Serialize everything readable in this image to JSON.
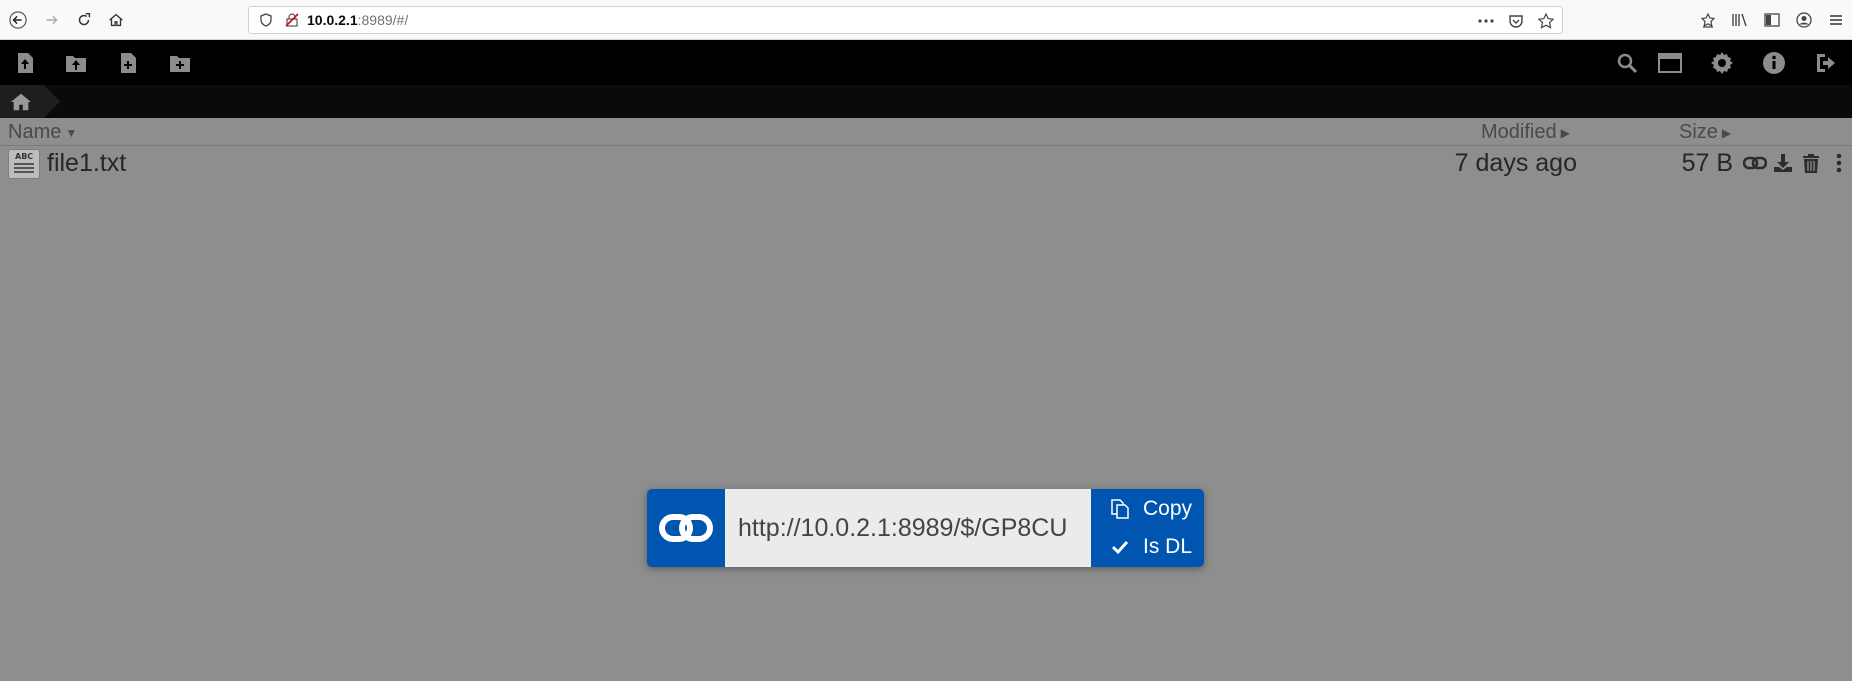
{
  "browser": {
    "url_host": "10.0.2.1",
    "url_path": ":8989/#/"
  },
  "table": {
    "headers": {
      "name": "Name",
      "modified": "Modified",
      "size": "Size"
    },
    "rows": [
      {
        "name": "file1.txt",
        "modified": "7 days ago",
        "size": "57 B",
        "icon": "text-file-icon"
      }
    ]
  },
  "share": {
    "url": "http://10.0.2.1:8989/$/GP8CU",
    "copy_label": "Copy",
    "is_dl_label": "Is DL",
    "is_dl_checked": true
  },
  "colors": {
    "accent": "#0055b0",
    "overlay_bg": "#8e8e8e",
    "toolbar_bg": "#000000"
  }
}
